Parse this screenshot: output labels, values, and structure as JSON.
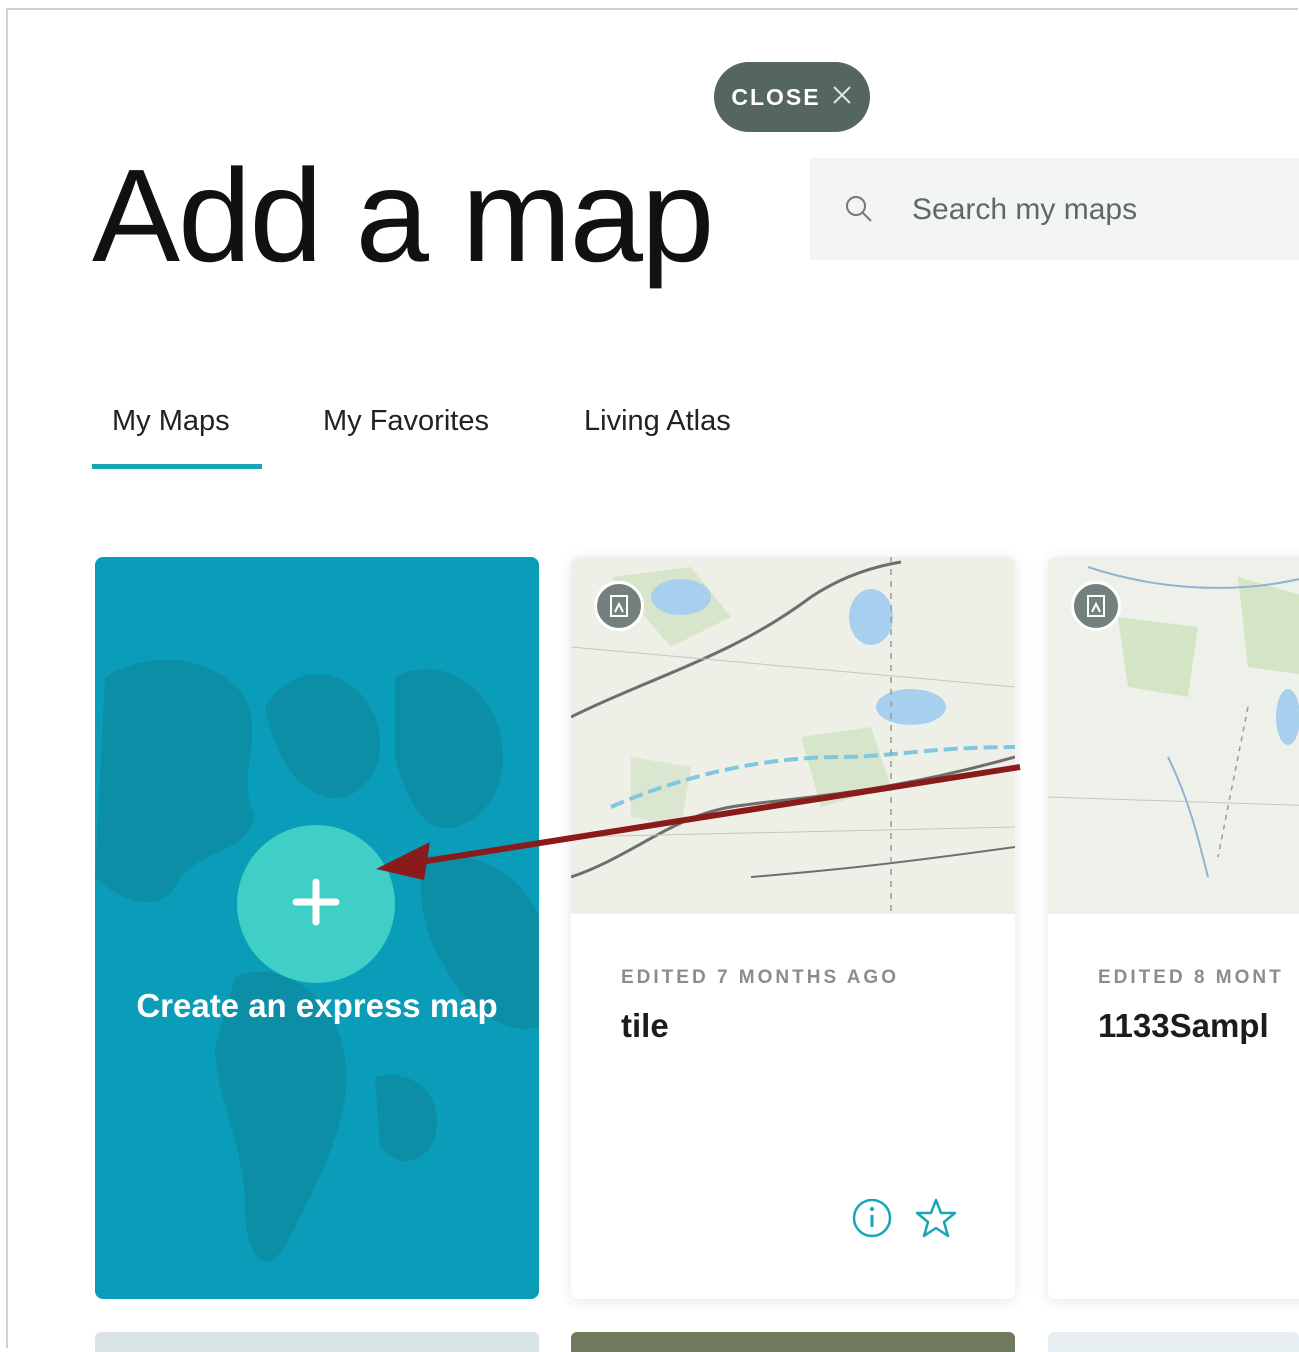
{
  "close_button": {
    "label": "CLOSE",
    "icon": "close-icon"
  },
  "page": {
    "title": "Add a map"
  },
  "search": {
    "placeholder": "Search my maps",
    "value": "",
    "icon": "search-icon"
  },
  "tabs": [
    {
      "label": "My Maps",
      "active": true
    },
    {
      "label": "My Favorites",
      "active": false
    },
    {
      "label": "Living Atlas",
      "active": false
    }
  ],
  "express_card": {
    "label": "Create an express map",
    "icon": "plus-icon",
    "color": "#0a9dba",
    "button_color": "#40cfc6"
  },
  "maps": [
    {
      "edited": "EDITED 7 MONTHS AGO",
      "name": "tile",
      "badge_icon": "map-badge-icon",
      "actions": [
        "info-icon",
        "star-icon"
      ]
    },
    {
      "edited": "EDITED 8 MONT",
      "name": "1133Sampl",
      "badge_icon": "map-badge-icon"
    }
  ],
  "colors": {
    "accent": "#17a6b6",
    "close_bg": "#546562",
    "annotation_arrow": "#8b1a1a"
  }
}
